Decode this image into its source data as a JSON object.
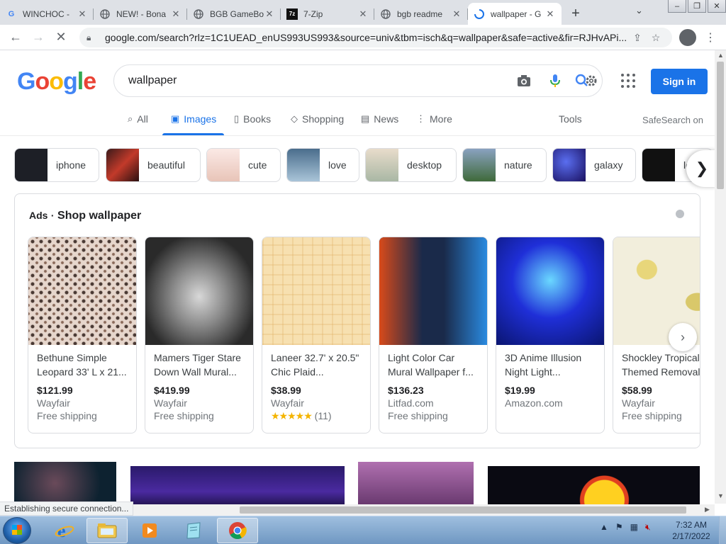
{
  "browser": {
    "tabs": [
      {
        "title": "WINCHOC -",
        "favicon": "google-g-icon"
      },
      {
        "title": "NEW! - Bona",
        "favicon": "globe-icon"
      },
      {
        "title": "BGB GameBo",
        "favicon": "globe-icon"
      },
      {
        "title": "7-Zip",
        "favicon": "7zip-icon",
        "fav_text": "7z"
      },
      {
        "title": "bgb readme",
        "favicon": "globe-icon"
      },
      {
        "title": "wallpaper - G",
        "favicon": "loading-spinner-icon",
        "active": true
      }
    ],
    "new_tab_label": "+",
    "url": "google.com/search?rlz=1C1UEAD_enUS993US993&source=univ&tbm=isch&q=wallpaper&safe=active&fir=RJHvAPi..."
  },
  "google": {
    "logo_text": [
      "G",
      "o",
      "o",
      "g",
      "l",
      "e"
    ],
    "query": "wallpaper",
    "sign_in_label": "Sign in",
    "nav_tabs": [
      {
        "label": "All",
        "icon": "search-icon"
      },
      {
        "label": "Images",
        "icon": "image-icon",
        "active": true
      },
      {
        "label": "Books",
        "icon": "book-icon"
      },
      {
        "label": "Shopping",
        "icon": "tag-icon"
      },
      {
        "label": "News",
        "icon": "newspaper-icon"
      },
      {
        "label": "More",
        "icon": "more-vert-icon"
      }
    ],
    "tools_label": "Tools",
    "safesearch_label": "SafeSearch on",
    "chips": [
      {
        "label": "iphone",
        "color": "#1d1f26"
      },
      {
        "label": "beautiful",
        "color": "#8a2a2a"
      },
      {
        "label": "cute",
        "color": "#f3d9d6"
      },
      {
        "label": "love",
        "color": "#6f8fa8"
      },
      {
        "label": "desktop",
        "color": "#d9cbb7"
      },
      {
        "label": "nature",
        "color": "#4a6b3d"
      },
      {
        "label": "galaxy",
        "color": "#2b2a8a"
      },
      {
        "label": "lo",
        "color": "#111111"
      }
    ],
    "ads": {
      "ads_label": "Ads",
      "separator": "·",
      "title": "Shop wallpaper",
      "products": [
        {
          "title": "Bethune Simple Leopard 33' L x 21...",
          "price": "$121.99",
          "store": "Wayfair",
          "extra": "Free shipping",
          "color": "#d8c8c0"
        },
        {
          "title": "Mamers Tiger Stare Down Wall Mural...",
          "price": "$419.99",
          "store": "Wayfair",
          "extra": "Free shipping",
          "color": "#5a5a5a"
        },
        {
          "title": "Laneer 32.7' x 20.5\" Chic Plaid...",
          "price": "$38.99",
          "store": "Wayfair",
          "rating_stars": "★★★★★",
          "rating_count": "(11)",
          "color": "#f6dca8"
        },
        {
          "title": "Light Color Car Mural Wallpaper f...",
          "price": "$136.23",
          "store": "Litfad.com",
          "extra": "Free shipping",
          "color": "#2a3b5a"
        },
        {
          "title": "3D Anime Illusion Night Light...",
          "price": "$19.99",
          "store": "Amazon.com",
          "extra": "",
          "color": "#1f2fd8"
        },
        {
          "title": "Shockley Tropical Themed Removal",
          "price": "$58.99",
          "store": "Wayfair",
          "extra": "Free shipping",
          "color": "#ece6c8"
        }
      ]
    }
  },
  "status_text": "Establishing secure connection...",
  "taskbar": {
    "apps": [
      "internet-explorer-icon",
      "file-explorer-icon",
      "media-player-icon",
      "notepad-icon",
      "chrome-icon"
    ],
    "time": "7:32 AM",
    "date": "2/17/2022"
  }
}
